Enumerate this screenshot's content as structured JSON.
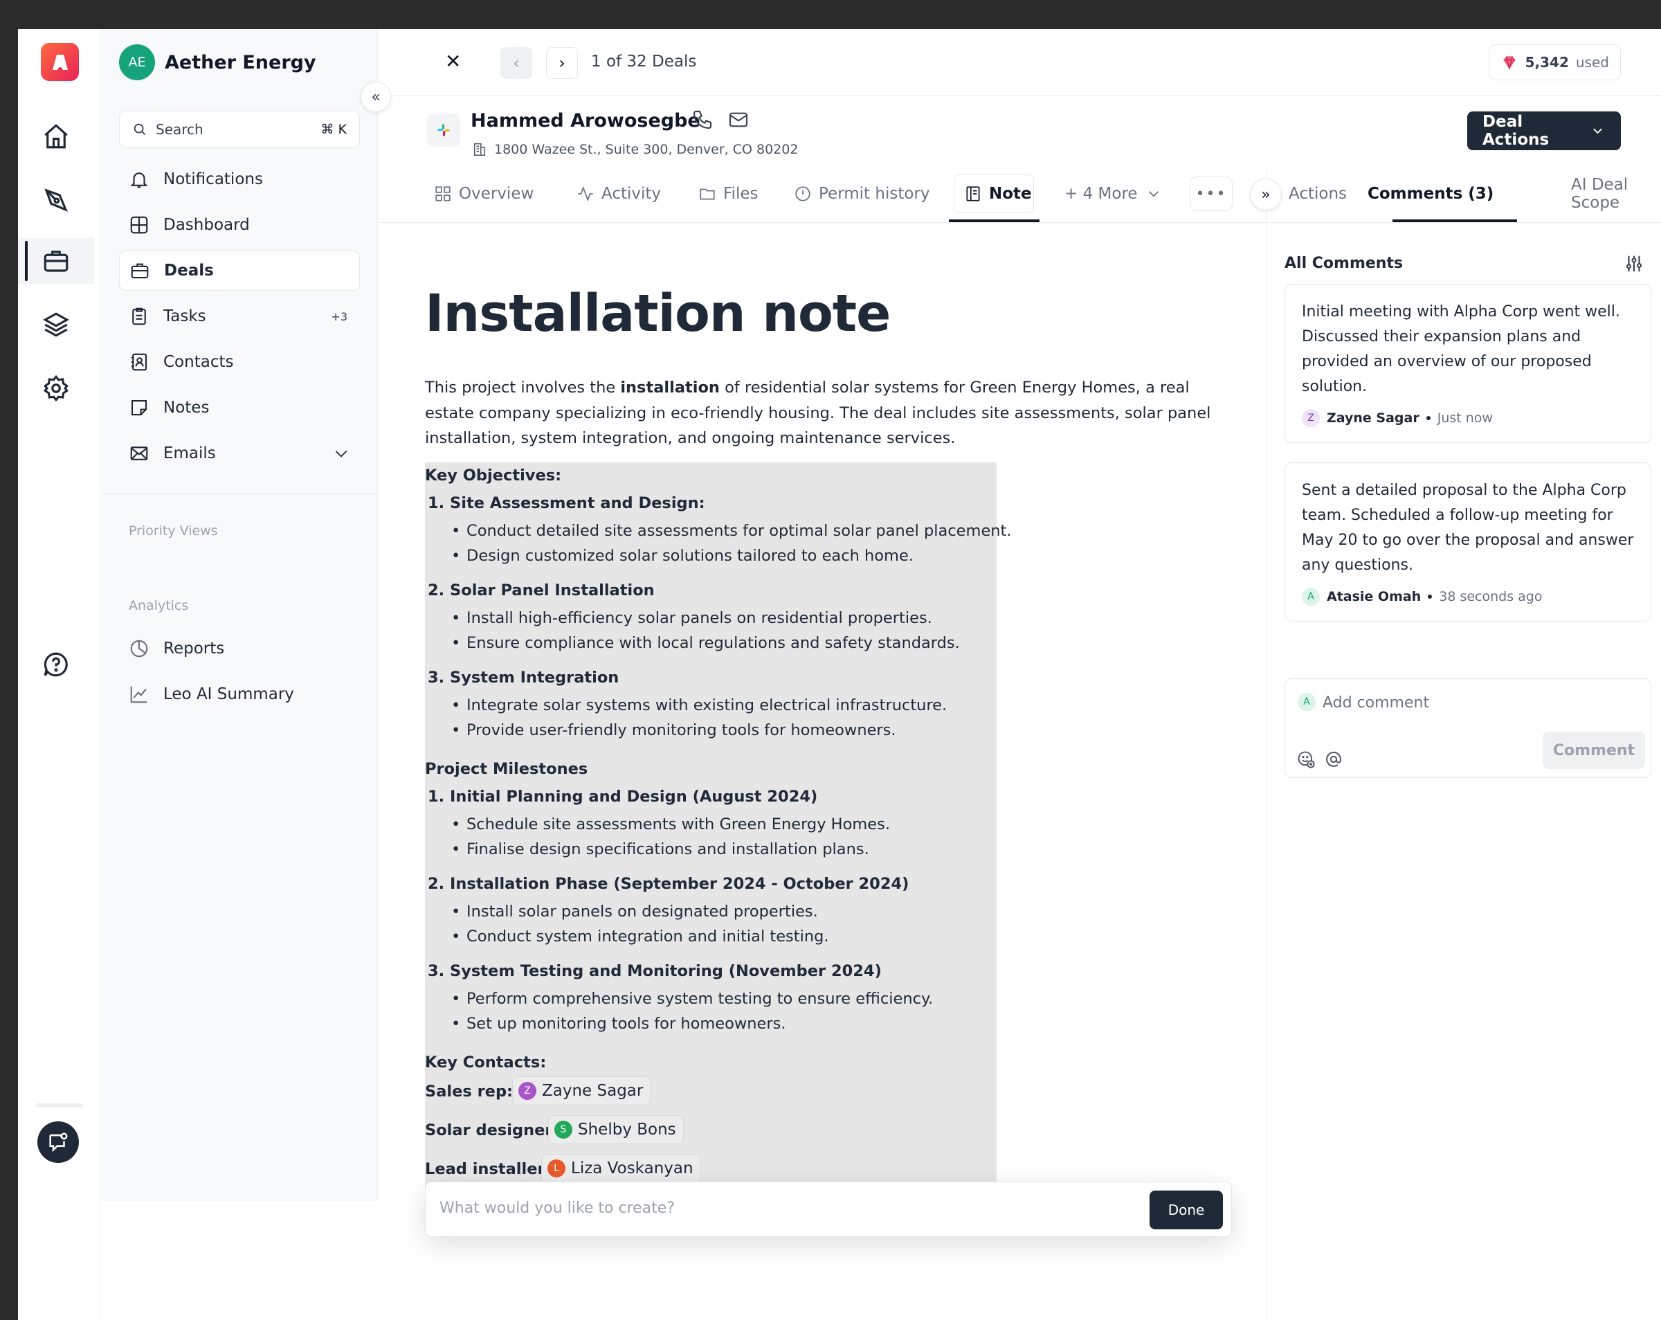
{
  "workspace": {
    "initials": "AE",
    "name": "Aether Energy"
  },
  "search": {
    "label": "Search",
    "shortcut": "⌘ K"
  },
  "nav": [
    {
      "label": "Notifications",
      "icon": "bell-icon"
    },
    {
      "label": "Dashboard",
      "icon": "grid-icon"
    },
    {
      "label": "Deals",
      "icon": "briefcase-icon",
      "active": true
    },
    {
      "label": "Tasks",
      "icon": "clipboard-icon",
      "badge": "+3"
    },
    {
      "label": "Contacts",
      "icon": "contact-book-icon"
    },
    {
      "label": "Notes",
      "icon": "note-icon"
    },
    {
      "label": "Emails",
      "icon": "mail-icon"
    }
  ],
  "sections": {
    "priority": "Priority Views",
    "analytics": "Analytics"
  },
  "analytics_nav": [
    {
      "label": "Reports",
      "icon": "pie-chart-icon"
    },
    {
      "label": "Leo AI Summary",
      "icon": "trend-chart-icon"
    }
  ],
  "header": {
    "pager_text": "1 of 32 Deals",
    "credits_value": "5,342",
    "credits_suffix": "used"
  },
  "deal": {
    "name": "Hammed Arowosegbe",
    "address": "1800 Wazee St., Suite 300, Denver, CO 80202",
    "actions_label": "Deal Actions"
  },
  "tabs": [
    {
      "label": "Overview",
      "icon": "overview-icon"
    },
    {
      "label": "Activity",
      "icon": "activity-icon"
    },
    {
      "label": "Files",
      "icon": "folder-icon"
    },
    {
      "label": "Permit history",
      "icon": "alert-circle-icon"
    },
    {
      "label": "Note",
      "icon": "note-doc-icon",
      "active": true
    },
    {
      "label": "+ 4 More",
      "icon": "chevron-down-icon"
    }
  ],
  "right_tabs": [
    {
      "label": "Actions"
    },
    {
      "label": "Comments (3)",
      "active": true
    },
    {
      "label": "AI Deal Scope"
    }
  ],
  "comments_panel": {
    "title": "All Comments",
    "comments": [
      {
        "text": "Initial meeting with Alpha Corp went well. Discussed their expansion plans and provided an overview of our proposed solution.",
        "initial": "Z",
        "author": "Zayne Sagar",
        "time": "Just now",
        "avatar_bg": "#efe3f7",
        "avatar_fg": "#7e3fb0"
      },
      {
        "text": "Sent a detailed proposal to the Alpha Corp team. Scheduled a follow-up meeting for May 20 to go over the proposal and answer any questions.",
        "initial": "A",
        "author": "Atasie Omah",
        "time": "38 seconds ago",
        "avatar_bg": "#dcf5e8",
        "avatar_fg": "#16a37a"
      }
    ],
    "add_initial": "A",
    "add_placeholder": "Add comment",
    "button_label": "Comment"
  },
  "note": {
    "title": "Installation note",
    "intro_before": "This project involves the ",
    "intro_bold": "installation",
    "intro_after": " of residential solar systems for Green Energy Homes, a real estate company specializing in eco-friendly housing. The deal includes site assessments, solar panel installation, system integration, and ongoing maintenance services.",
    "objectives_heading": "Key Objectives:",
    "objectives": [
      {
        "title": "1. Site Assessment and Design:",
        "bullets": [
          "Conduct detailed site assessments for optimal solar panel placement.",
          "Design customized solar solutions tailored to each home."
        ]
      },
      {
        "title": "2. Solar Panel Installation",
        "bullets": [
          "Install high-efficiency solar panels on residential properties.",
          "Ensure compliance with local regulations and safety standards."
        ]
      },
      {
        "title": "3. System Integration",
        "bullets": [
          "Integrate solar systems with existing electrical infrastructure.",
          "Provide user-friendly monitoring tools for homeowners."
        ]
      }
    ],
    "milestones_heading": "Project Milestones",
    "milestones": [
      {
        "title": "1. Initial Planning and Design (August 2024)",
        "bullets": [
          "Schedule site assessments with Green Energy Homes.",
          "Finalise design specifications and installation plans."
        ]
      },
      {
        "title": "2. Installation Phase (September 2024 - October 2024)",
        "bullets": [
          "Install solar panels on designated properties.",
          "Conduct system integration and initial testing."
        ]
      },
      {
        "title": "3. System Testing and Monitoring (November 2024)",
        "bullets": [
          "Perform comprehensive system testing to ensure efficiency.",
          "Set up monitoring tools for homeowners."
        ]
      }
    ],
    "contacts_heading": "Key Contacts:",
    "contacts": [
      {
        "role": "Sales rep:",
        "initial": "Z",
        "name": "Zayne Sagar",
        "color": "#a855c7"
      },
      {
        "role": "Solar designer",
        "initial": "S",
        "name": "Shelby Bons",
        "color": "#22a85a"
      },
      {
        "role": "Lead installer",
        "initial": "L",
        "name": "Liza Voskanyan",
        "color": "#e85a2a"
      }
    ]
  },
  "prompt": {
    "placeholder": "What would you like to create?",
    "button": "Done"
  }
}
